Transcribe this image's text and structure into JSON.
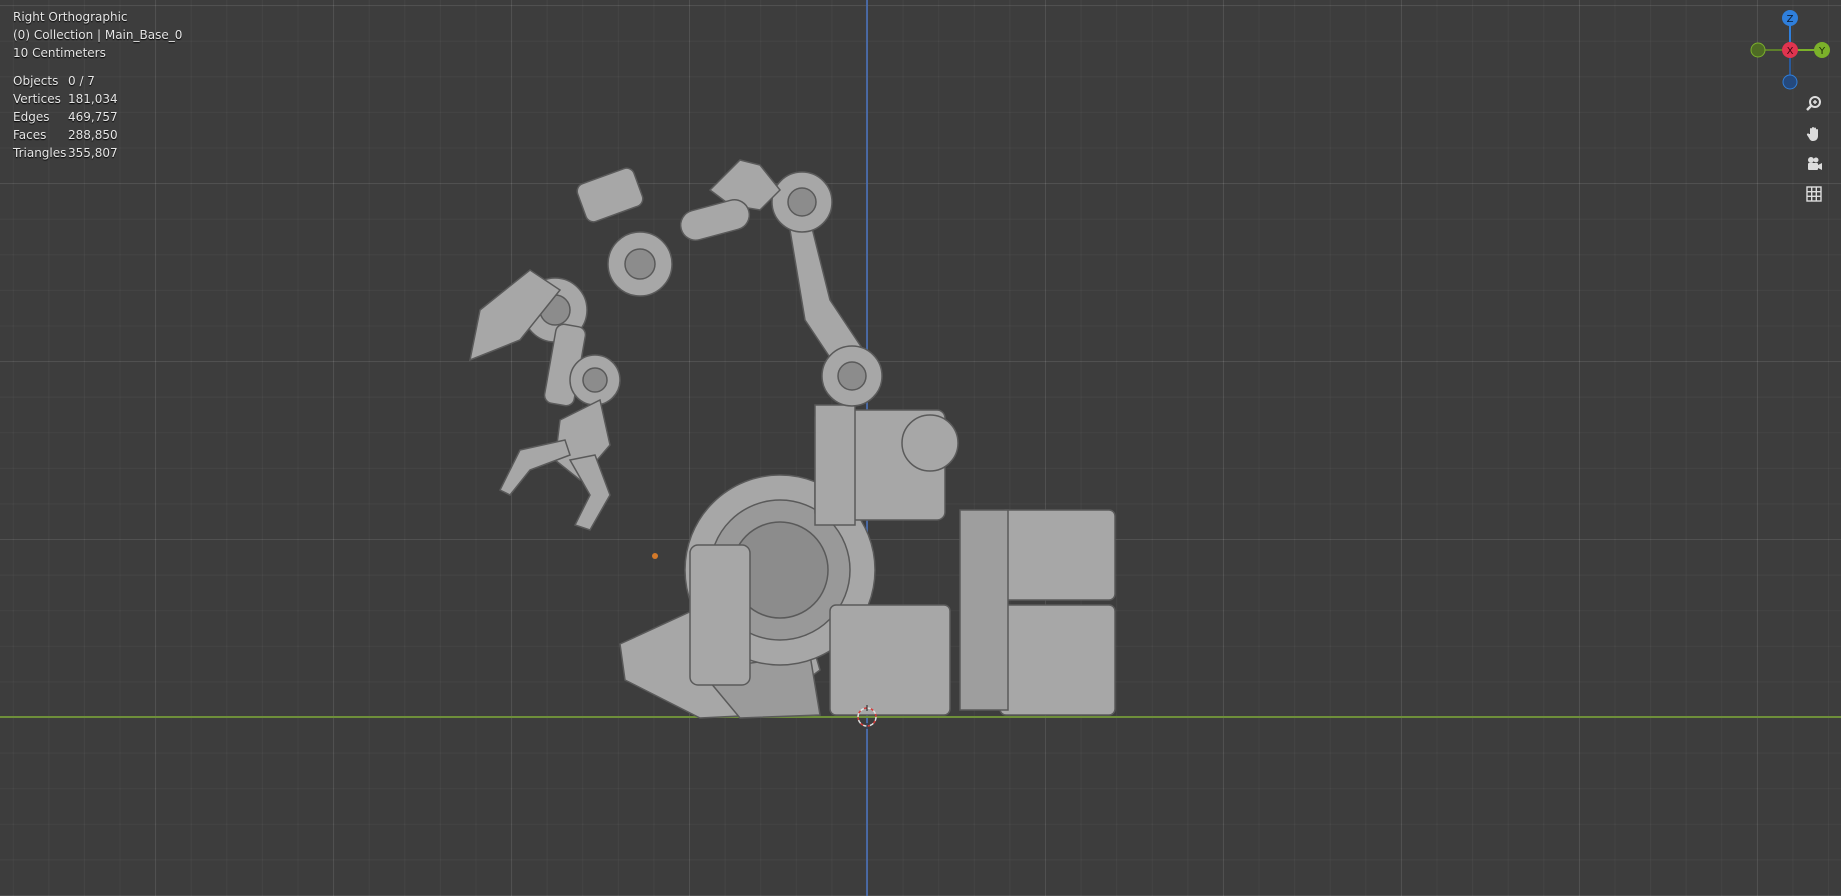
{
  "viewport": {
    "view_name": "Right Orthographic",
    "collection_line": "(0) Collection | Main_Base_0",
    "scale_line": "10 Centimeters",
    "stats": [
      {
        "label": "Objects",
        "value": "0 / 7"
      },
      {
        "label": "Vertices",
        "value": "181,034"
      },
      {
        "label": "Edges",
        "value": "469,757"
      },
      {
        "label": "Faces",
        "value": "288,850"
      },
      {
        "label": "Triangles",
        "value": "355,807"
      }
    ]
  },
  "gizmo": {
    "z_label": "Z",
    "x_label": "X",
    "y_label": "Y",
    "colors": {
      "z": "#2f7fdc",
      "x": "#e0344f",
      "y": "#7bb12a"
    }
  },
  "nav_icons": [
    "zoom-icon",
    "hand-pan-icon",
    "camera-icon",
    "grid-ortho-icon"
  ]
}
